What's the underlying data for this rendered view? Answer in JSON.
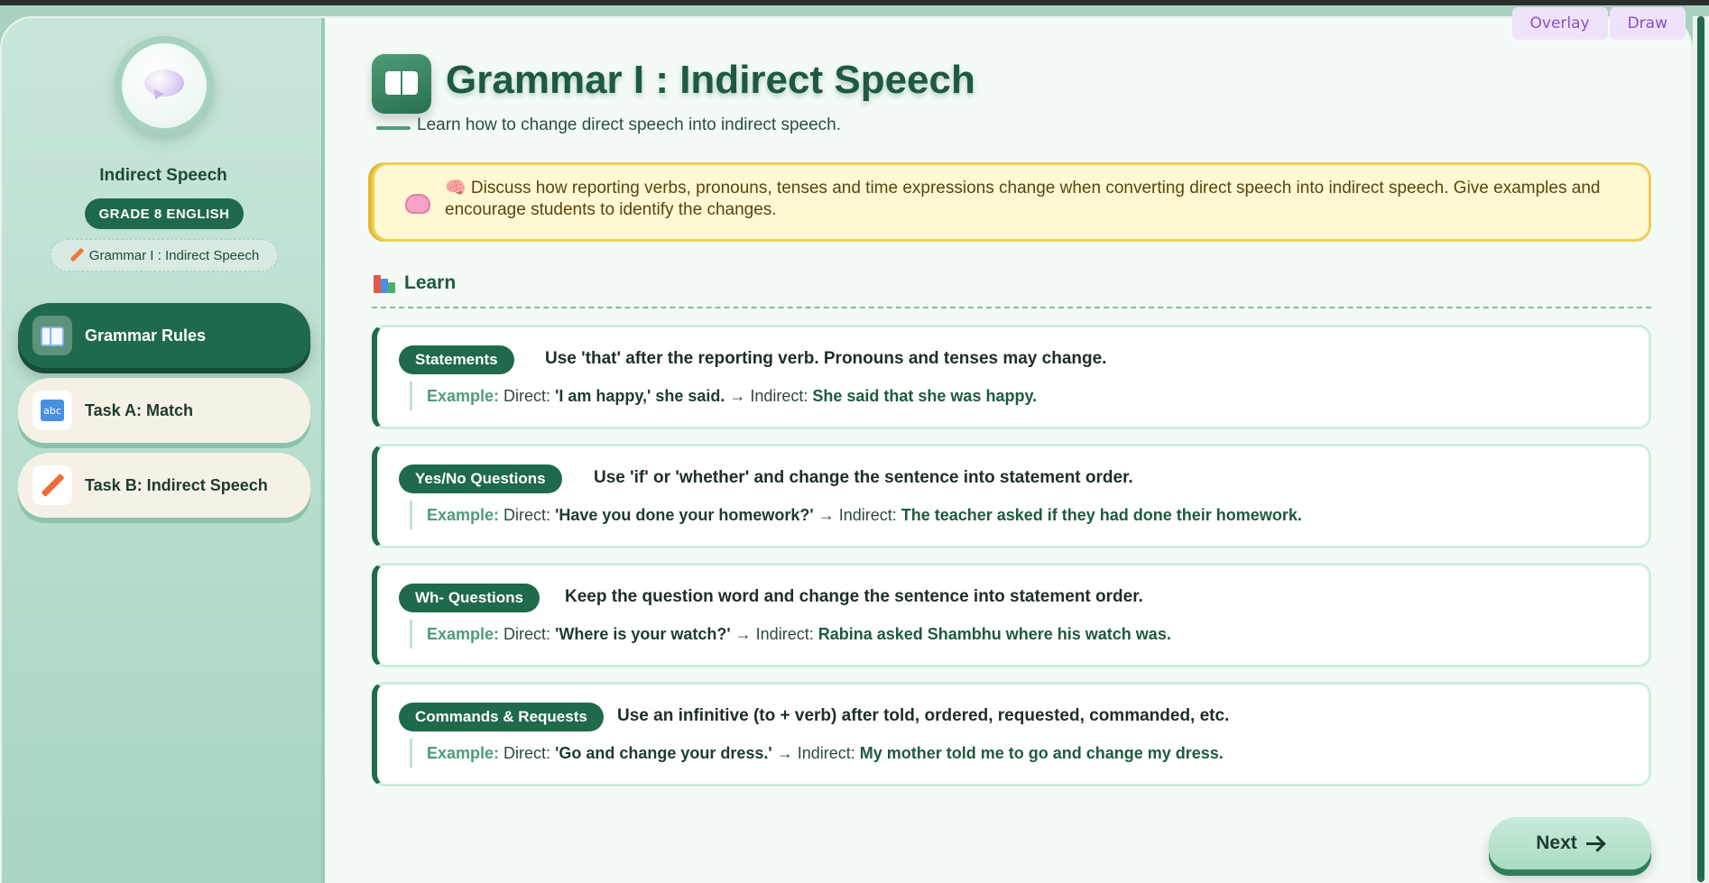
{
  "tools": {
    "overlay_label": "Overlay",
    "draw_label": "Draw"
  },
  "sidebar": {
    "title": "Indirect Speech",
    "grade": "GRADE 8 ENGLISH",
    "lesson": "Grammar I : Indirect Speech",
    "items": [
      {
        "label": "Grammar Rules",
        "icon": "book-icon",
        "active": true
      },
      {
        "label": "Task A: Match",
        "icon": "abc-icon",
        "active": false
      },
      {
        "label": "Task B: Indirect Speech",
        "icon": "pencil-icon",
        "active": false
      }
    ]
  },
  "main": {
    "title": "Grammar I : Indirect Speech",
    "subtitle": "Learn how to change direct speech into indirect speech.",
    "note": "🧠 Discuss how reporting verbs, pronouns, tenses and time expressions change when converting direct speech into indirect speech. Give examples and encourage students to identify the changes.",
    "learn_heading": "Learn",
    "example_label": "Example:",
    "direct_label": "Direct:",
    "arrow": "→",
    "indirect_label": "Indirect:",
    "rules": [
      {
        "badge": "Statements",
        "text": "Use 'that' after the reporting verb. Pronouns and tenses may change.",
        "direct": "'I am happy,' she said.",
        "indirect": "She said that she was happy."
      },
      {
        "badge": "Yes/No Questions",
        "text": "Use 'if' or 'whether' and change the sentence into statement order.",
        "direct": "'Have you done your homework?'",
        "indirect": "The teacher asked if they had done their homework."
      },
      {
        "badge": "Wh- Questions",
        "text": "Keep the question word and change the sentence into statement order.",
        "direct": "'Where is your watch?'",
        "indirect": "Rabina asked Shambhu where his watch was."
      },
      {
        "badge": "Commands & Requests",
        "text": "Use an infinitive (to + verb) after told, ordered, requested, commanded, etc.",
        "direct": "'Go and change your dress.'",
        "indirect": "My mother told me to go and change my dress."
      }
    ],
    "next_label": "Next"
  },
  "colors": {
    "primary": "#1f6a4a",
    "accent": "#4f9c78",
    "note_bg": "#fff8d2",
    "note_border": "#efcf55",
    "tool_text": "#8a4fc7"
  }
}
